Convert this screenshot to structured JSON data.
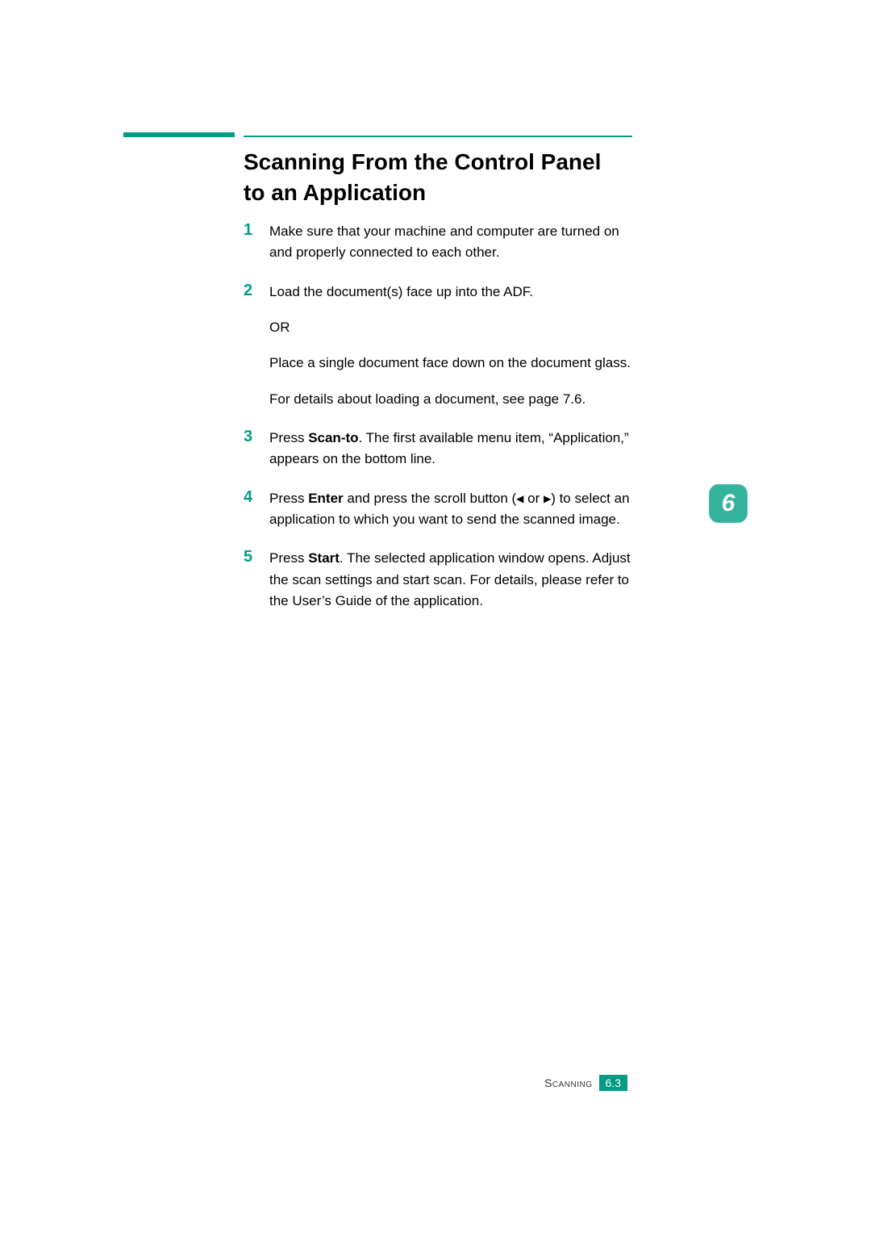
{
  "heading": {
    "line1": "Scanning From the Control Panel",
    "line2": "to an Application"
  },
  "steps": [
    {
      "num": "1",
      "paras": [
        {
          "type": "plain",
          "text": "Make sure that your machine and computer are turned on and properly connected to each other."
        }
      ]
    },
    {
      "num": "2",
      "paras": [
        {
          "type": "plain",
          "text": "Load the document(s) face up into the ADF."
        },
        {
          "type": "plain",
          "text": "OR"
        },
        {
          "type": "plain",
          "text": "Place a single document face down on the document glass."
        },
        {
          "type": "plain",
          "text": "For details about loading a document, see page 7.6."
        }
      ]
    },
    {
      "num": "3",
      "paras": [
        {
          "type": "press-scan-to",
          "pre": "Press ",
          "bold": "Scan-to",
          "post": ". The first available menu item, “Application,” appears on the bottom line."
        }
      ]
    },
    {
      "num": "4",
      "paras": [
        {
          "type": "press-enter",
          "pre": "Press ",
          "bold": "Enter",
          "mid": " and press the scroll button (",
          "or_word": " or ",
          "post": ") to select an application to which you want to send the scanned image."
        }
      ]
    },
    {
      "num": "5",
      "paras": [
        {
          "type": "press-start",
          "pre": "Press ",
          "bold": "Start",
          "post": ". The selected application window opens. Adjust the scan settings and start scan. For details, please refer to the User’s Guide of the application."
        }
      ]
    }
  ],
  "side_tab": {
    "chapter": "6"
  },
  "footer": {
    "section": "Scanning",
    "page": "6.3"
  },
  "icons": {
    "triangle_left": "◀",
    "triangle_right": "▶"
  }
}
